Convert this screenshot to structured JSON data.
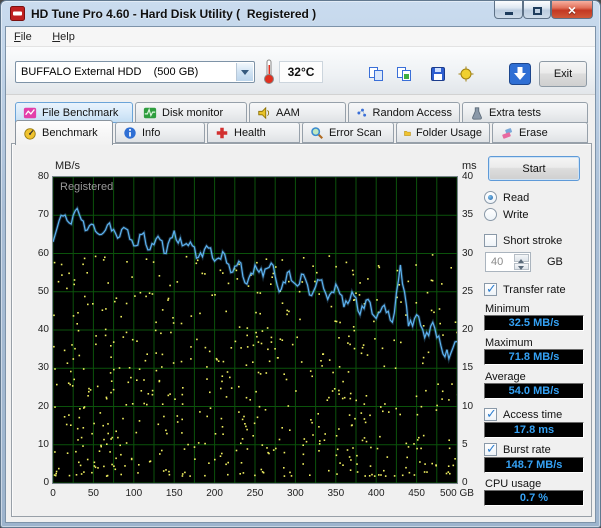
{
  "window": {
    "title": "HD Tune Pro 4.60 - Hard Disk Utility (  Registered )"
  },
  "menu": {
    "file": "File",
    "help": "Help"
  },
  "toolbar": {
    "drive": "BUFFALO External HDD    (500 GB)",
    "temperature": "32°C",
    "exit": "Exit"
  },
  "icons": {
    "app": "red-disk-app-icon",
    "thermometer": "thermometer",
    "copy_text": "copy-pages",
    "copy_image": "copy-image",
    "save": "floppy-disk",
    "capture": "yellow-capture",
    "update": "blue-download-arrow",
    "tabs_row1": [
      "file-benchmark",
      "disk-monitor",
      "speaker",
      "random-access",
      "extra-tests"
    ],
    "tabs_row2": [
      "gauge",
      "info",
      "health-cross",
      "magnifier",
      "folder",
      "eraser"
    ]
  },
  "tabs_row1": [
    {
      "label": "File Benchmark"
    },
    {
      "label": "Disk monitor"
    },
    {
      "label": "AAM"
    },
    {
      "label": "Random Access"
    },
    {
      "label": "Extra tests"
    }
  ],
  "tabs_row2": [
    {
      "label": "Benchmark"
    },
    {
      "label": "Info"
    },
    {
      "label": "Health"
    },
    {
      "label": "Error Scan"
    },
    {
      "label": "Folder Usage"
    },
    {
      "label": "Erase"
    }
  ],
  "controls": {
    "start": "Start",
    "read": "Read",
    "write": "Write",
    "short_stroke": "Short stroke",
    "short_stroke_value": "40",
    "short_stroke_unit": "GB",
    "transfer_rate": "Transfer rate",
    "minimum_label": "Minimum",
    "minimum_value": "32.5 MB/s",
    "maximum_label": "Maximum",
    "maximum_value": "71.8 MB/s",
    "average_label": "Average",
    "average_value": "54.0 MB/s",
    "access_time": "Access time",
    "access_time_value": "17.8 ms",
    "burst_rate": "Burst rate",
    "burst_rate_value": "148.7 MB/s",
    "cpu_usage_label": "CPU usage",
    "cpu_usage_value": "0.7 %"
  },
  "colors": {
    "value_text": "#35a2f5",
    "line": "#5db2f0",
    "dots": "#f0ef60",
    "grid": "#0b520b"
  },
  "chart_data": {
    "type": "line+scatter",
    "watermark": "Registered",
    "left_axis": {
      "label": "MB/s",
      "min": 0,
      "max": 80,
      "ticks": [
        80,
        70,
        60,
        50,
        40,
        30,
        20,
        10,
        0
      ]
    },
    "right_axis": {
      "label": "ms",
      "min": 0,
      "max": 40,
      "ticks": [
        40,
        35,
        30,
        25,
        20,
        15,
        10,
        5,
        0
      ]
    },
    "x_axis": {
      "min": 0,
      "max": 500,
      "unit": "GB",
      "ticks": [
        0,
        50,
        100,
        150,
        200,
        250,
        300,
        350,
        400,
        450,
        500
      ]
    },
    "grid": {
      "x_step": 25,
      "y_step": 10
    },
    "series": [
      {
        "name": "transfer-rate",
        "unit": "MB/s",
        "x_step": 10,
        "values": [
          63,
          70,
          68,
          71.8,
          66,
          67.5,
          65,
          68,
          64,
          66.5,
          62,
          65,
          61,
          64.5,
          60,
          66,
          62,
          63,
          59,
          62,
          58,
          60.5,
          55,
          58,
          52,
          57,
          54,
          57.5,
          50,
          55,
          52,
          54.5,
          49,
          53,
          48,
          52,
          46,
          50,
          44,
          48,
          43,
          46.5,
          42,
          57,
          41,
          44,
          38,
          42,
          36,
          32.5,
          37
        ]
      },
      {
        "name": "access-time",
        "unit": "ms",
        "style": "dots",
        "count": 560,
        "ms_min": 1,
        "ms_max": 30,
        "seed": 7
      }
    ],
    "summary": {
      "minimum_mbs": 32.5,
      "maximum_mbs": 71.8,
      "average_mbs": 54.0,
      "access_time_ms": 17.8,
      "burst_rate_mbs": 148.7,
      "cpu_usage_pct": 0.7
    }
  }
}
